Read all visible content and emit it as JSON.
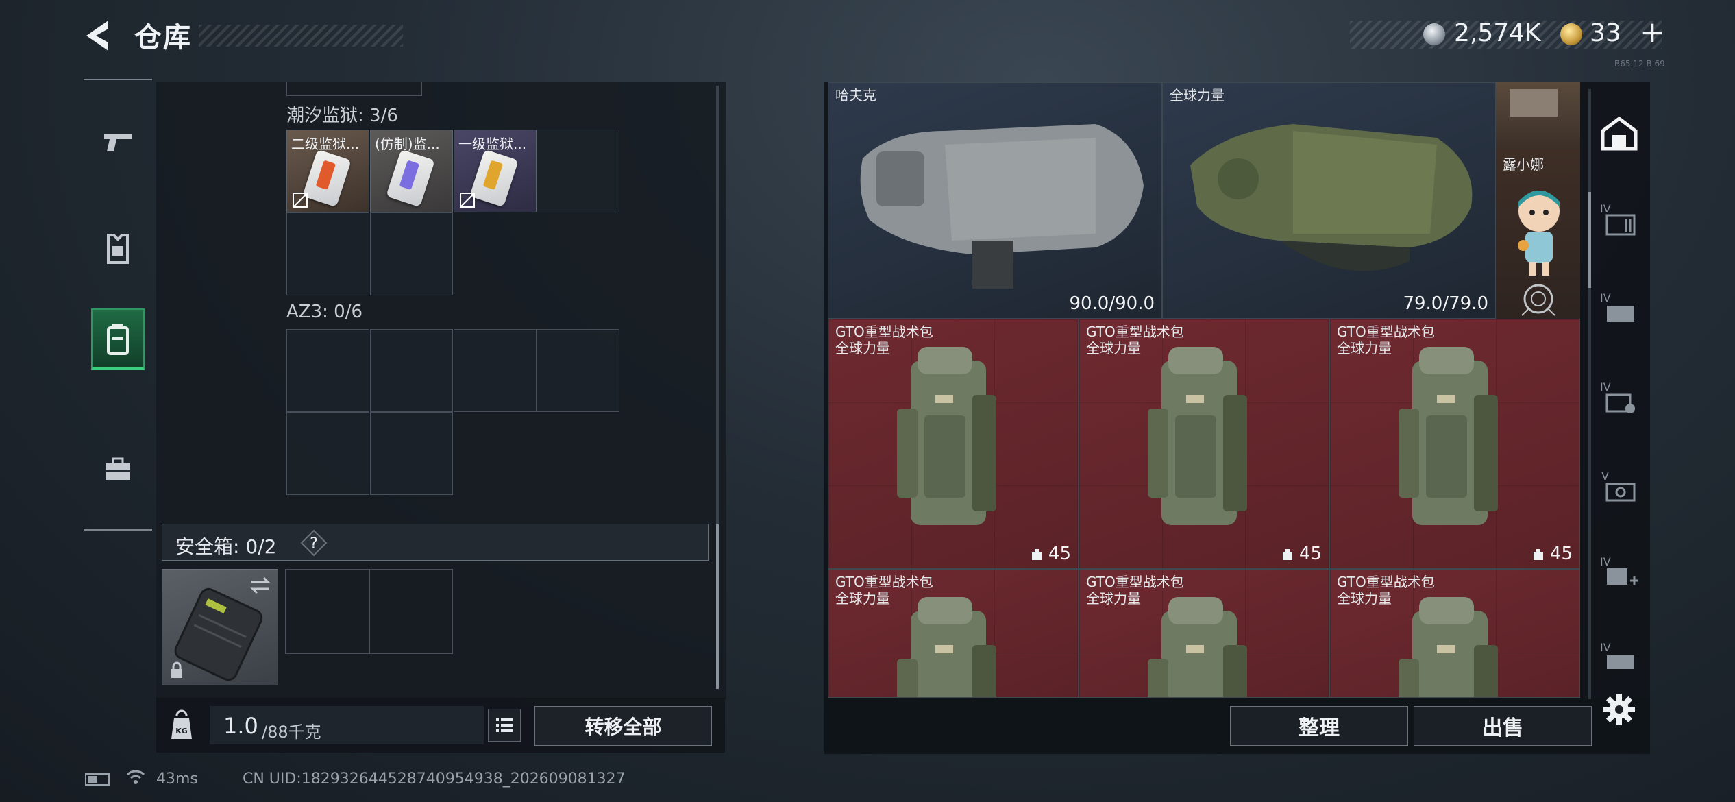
{
  "header": {
    "title": "仓库"
  },
  "currency": {
    "silver": "2,574K",
    "gold": "33",
    "plus": "+"
  },
  "version_tag": "B65.12 B.69",
  "sidebar": {
    "items": [
      {
        "name": "weapons"
      },
      {
        "name": "armor"
      },
      {
        "name": "backpack",
        "active": true
      },
      {
        "name": "toolbox"
      }
    ]
  },
  "left": {
    "section1_label": "潮汐监狱: 3/6",
    "section1_items": [
      {
        "name": "二级监狱...",
        "color": "#6a5a4e",
        "strip": "#e05a2c"
      },
      {
        "name": "(仿制)监...",
        "color": "#5d5a5a",
        "strip": "#7b6ee0"
      },
      {
        "name": "一级监狱...",
        "color": "#4a4666",
        "strip": "#e0a52c"
      }
    ],
    "section2_label": "AZ3: 0/6",
    "safe_label": "安全箱: 0/2",
    "safe_help": "?"
  },
  "footer_left": {
    "weight_current": "1.0",
    "weight_max": "/88千克",
    "transfer_label": "转移全部",
    "weight_icon": "KG"
  },
  "status": {
    "ping": "43ms",
    "uid": "CN UID:1829326445287409549​38_202609081327"
  },
  "right": {
    "armor": [
      {
        "name": "哈夫克",
        "durability": "90.0/90.0"
      },
      {
        "name": "全球力量",
        "durability": "79.0/79.0"
      }
    ],
    "charm_name": "露小娜",
    "packs": [
      {
        "name": "GTO重型战术包",
        "maker": "全球力量",
        "capacity": "45"
      },
      {
        "name": "GTO重型战术包",
        "maker": "全球力量",
        "capacity": "45"
      },
      {
        "name": "GTO重型战术包",
        "maker": "全球力量",
        "capacity": "45"
      },
      {
        "name": "GTO重型战术包",
        "maker": "全球力量",
        "capacity": ""
      },
      {
        "name": "GTO重型战术包",
        "maker": "全球力量",
        "capacity": ""
      },
      {
        "name": "GTO重型战术包",
        "maker": "全球力量",
        "capacity": ""
      }
    ],
    "organize_label": "整理",
    "sell_label": "出售"
  },
  "rail": {
    "items": [
      "IV",
      "IV",
      "IV",
      "V",
      "IV",
      "IV"
    ]
  }
}
